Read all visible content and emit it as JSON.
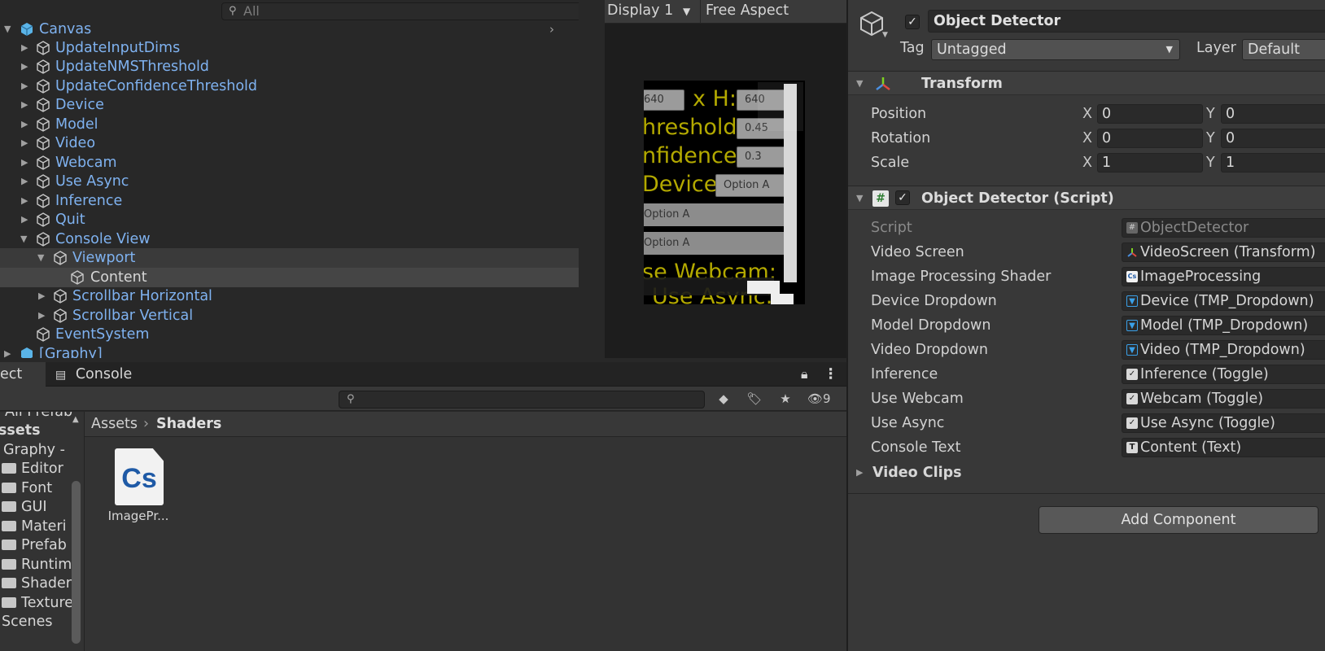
{
  "hierarchy": {
    "search_placeholder": "All",
    "items": [
      {
        "label": "Canvas"
      },
      {
        "label": "UpdateInputDims"
      },
      {
        "label": "UpdateNMSThreshold"
      },
      {
        "label": "UpdateConfidenceThreshold"
      },
      {
        "label": "Device"
      },
      {
        "label": "Model"
      },
      {
        "label": "Video"
      },
      {
        "label": "Webcam"
      },
      {
        "label": "Use Async"
      },
      {
        "label": "Inference"
      },
      {
        "label": "Quit"
      },
      {
        "label": "Console View"
      },
      {
        "label": "Viewport"
      },
      {
        "label": "Content"
      },
      {
        "label": "Scrollbar Horizontal"
      },
      {
        "label": "Scrollbar Vertical"
      },
      {
        "label": "EventSystem"
      },
      {
        "label": "[Graphy]"
      }
    ]
  },
  "game": {
    "display": "Display 1",
    "aspect": "Free Aspect",
    "screen": {
      "input_w": "640",
      "xh_label": "x H:",
      "input_h": "640",
      "threshold_label": "hreshold:",
      "threshold_value": "0.45",
      "confidence_label": "nfidence:",
      "confidence_value": "0.3",
      "device_label": "Device:",
      "device_option": "Option A",
      "model_option": "Option A",
      "video_option": "Option A",
      "webcam_label": "se Webcam:",
      "async_label": "Use Async:"
    }
  },
  "project": {
    "tabs": {
      "project": "ect",
      "console": "Console"
    },
    "hidden_count": "9",
    "breadcrumb": {
      "root": "Assets",
      "current": "Shaders"
    },
    "tree": [
      {
        "label": "All Prefab"
      },
      {
        "label": "ssets"
      },
      {
        "label": "Graphy -"
      },
      {
        "label": "Editor"
      },
      {
        "label": "Font"
      },
      {
        "label": "GUI"
      },
      {
        "label": "Materi"
      },
      {
        "label": "Prefab"
      },
      {
        "label": "Runtim"
      },
      {
        "label": "Shader"
      },
      {
        "label": "Texture"
      },
      {
        "label": "Scenes"
      }
    ],
    "asset": {
      "icon_text": "Cs",
      "name": "ImagePr..."
    }
  },
  "inspector": {
    "object_name": "Object Detector",
    "tag_label": "Tag",
    "tag_value": "Untagged",
    "layer_label": "Layer",
    "layer_value": "Default",
    "transform": {
      "title": "Transform",
      "rows": [
        {
          "label": "Position",
          "x": "0",
          "y": "0"
        },
        {
          "label": "Rotation",
          "x": "0",
          "y": "0"
        },
        {
          "label": "Scale",
          "x": "1",
          "y": "1"
        }
      ]
    },
    "script_component": {
      "title": "Object Detector (Script)",
      "fields": [
        {
          "label": "Script",
          "value": "ObjectDetector"
        },
        {
          "label": "Video Screen",
          "value": "VideoScreen (Transform)"
        },
        {
          "label": "Image Processing Shader",
          "value": "ImageProcessing"
        },
        {
          "label": "Device Dropdown",
          "value": "Device (TMP_Dropdown)"
        },
        {
          "label": "Model Dropdown",
          "value": "Model (TMP_Dropdown)"
        },
        {
          "label": "Video Dropdown",
          "value": "Video (TMP_Dropdown)"
        },
        {
          "label": "Inference",
          "value": "Inference (Toggle)"
        },
        {
          "label": "Use Webcam",
          "value": "Webcam (Toggle)"
        },
        {
          "label": "Use Async",
          "value": "Use Async (Toggle)"
        },
        {
          "label": "Console Text",
          "value": "Content (Text)"
        }
      ],
      "video_clips_label": "Video Clips"
    },
    "add_component": "Add Component"
  },
  "colors": {
    "accent_blue": "#7fb2f0",
    "ui_yellow": "#b3a900",
    "panel": "#383838"
  }
}
